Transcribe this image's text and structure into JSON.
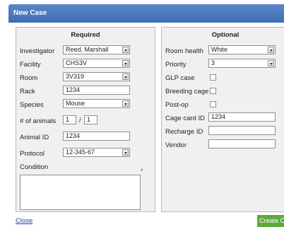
{
  "dialog": {
    "title": "New Case"
  },
  "required": {
    "heading": "Required",
    "investigator": {
      "label": "Investigator",
      "value": "Reed, Marshall"
    },
    "facility": {
      "label": "Facility",
      "value": "CHS3V"
    },
    "room": {
      "label": "Room",
      "value": "3V319"
    },
    "rack": {
      "label": "Rack",
      "value": "1234"
    },
    "species": {
      "label": "Species",
      "value": "Mouse"
    },
    "animals": {
      "label": "# of animals",
      "value": "1",
      "separator": "/",
      "total": "1"
    },
    "animal_id": {
      "label": "Animal ID",
      "value": "1234"
    },
    "protocol": {
      "label": "Protocol",
      "value": "12-345-67"
    },
    "condition": {
      "label": "Condition",
      "value": "",
      "required_mark": "*"
    }
  },
  "optional": {
    "heading": "Optional",
    "room_health": {
      "label": "Room health",
      "value": "White"
    },
    "priority": {
      "label": "Priority",
      "value": "3"
    },
    "glp_case": {
      "label": "GLP case",
      "checked": false
    },
    "breeding_cage": {
      "label": "Breeding cage",
      "checked": false
    },
    "post_op": {
      "label": "Post-op",
      "checked": false
    },
    "cage_card_id": {
      "label": "Cage card ID",
      "value": "1234"
    },
    "recharge_id": {
      "label": "Recharge ID",
      "value": ""
    },
    "vendor": {
      "label": "Vendor",
      "value": ""
    }
  },
  "footer": {
    "close_label": "Close",
    "create_label": "Create Case"
  },
  "colors": {
    "titlebar": "#3e6db3",
    "create_button": "#5ea93b",
    "link": "#1b3fa8"
  }
}
